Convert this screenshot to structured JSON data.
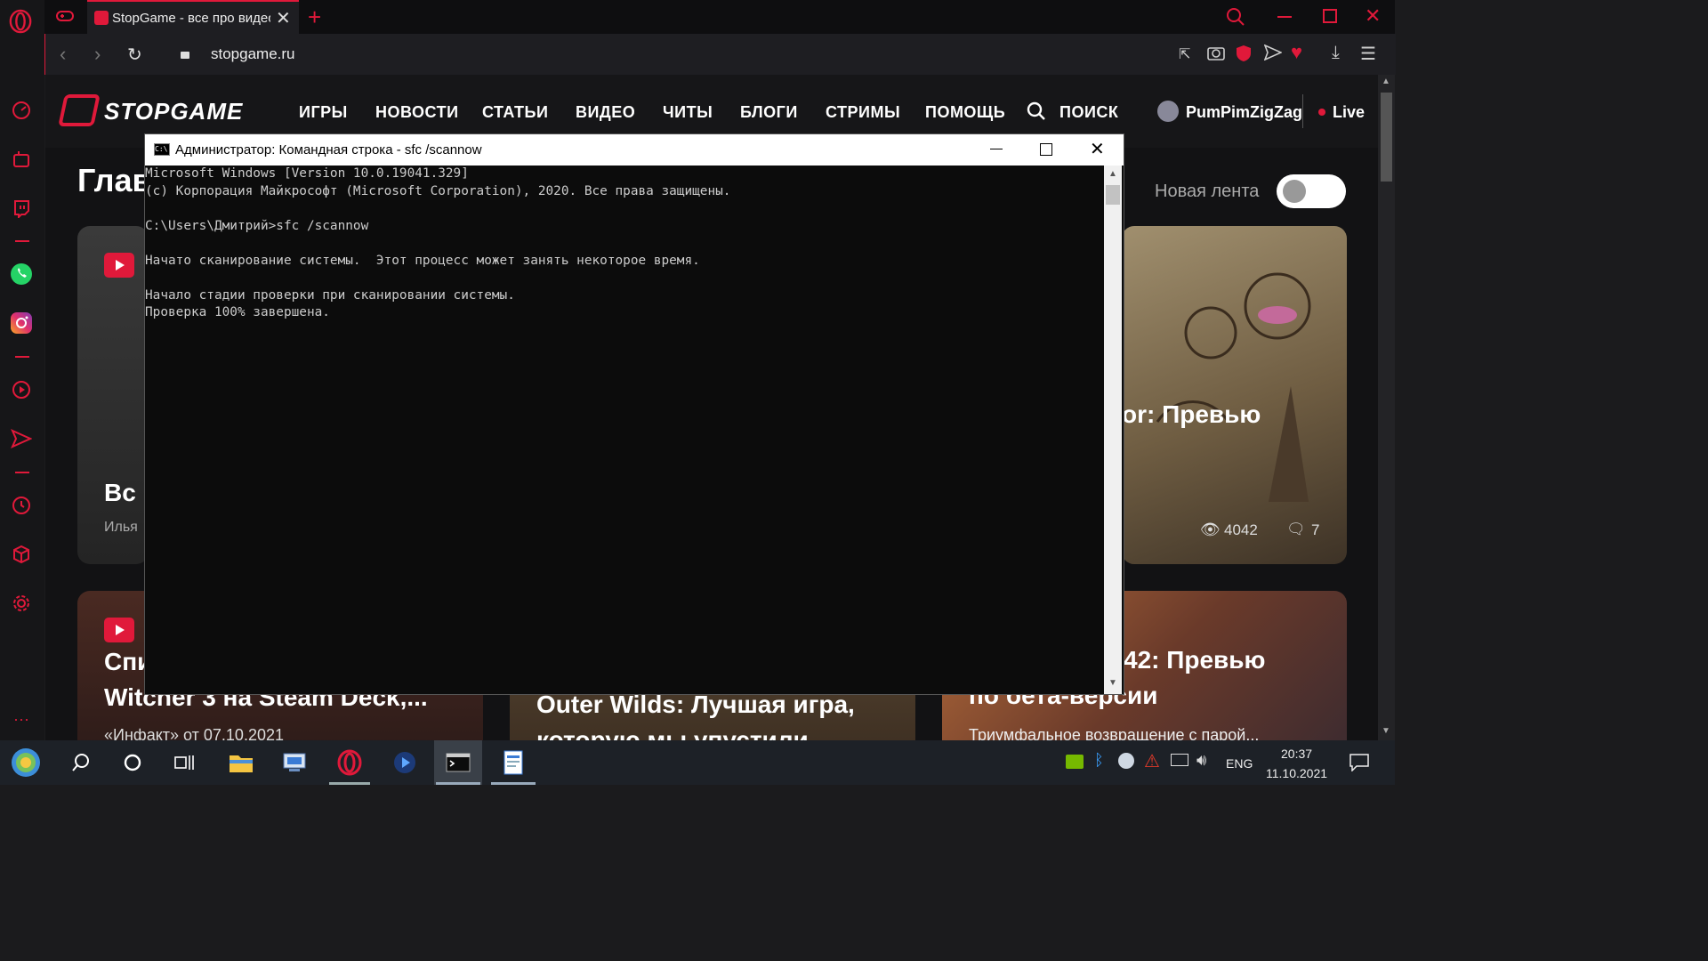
{
  "browser": {
    "tab_title": "StopGame - все про видео",
    "url": "stopgame.ru"
  },
  "site": {
    "logo": "STOPGAME",
    "nav": [
      "ИГРЫ",
      "НОВОСТИ",
      "СТАТЬИ",
      "ВИДЕО",
      "ЧИТЫ",
      "БЛОГИ",
      "СТРИМЫ",
      "ПОМОЩЬ"
    ],
    "search_label": "ПОИСК",
    "username": "PumPimZigZag",
    "live_label": "Live",
    "page_heading_partial": "Глав",
    "new_feed_label": "Новая лента",
    "card1": {
      "title_partial": "Вс",
      "author_partial": "Илья"
    },
    "card2": {
      "title_partial": "or: Превью",
      "views": "4042",
      "comments": "7"
    },
    "card3": {
      "title_line1_partial": "Спи",
      "title_line2": "Witcher 3 на Steam Deck,...",
      "subtitle": "«Инфакт» от 07.10.2021"
    },
    "card4": {
      "title_line1": "Outer Wilds: Лучшая игра,",
      "title_line2": "которую мы упустили"
    },
    "card5": {
      "title_line1": "42: Превью",
      "title_line2": "по бета-версии",
      "subtitle": "Триумфальное возвращение с парой..."
    }
  },
  "cmd": {
    "title": "Администратор: Командная строка - sfc  /scannow",
    "lines": [
      "Microsoft Windows [Version 10.0.19041.329]",
      "(c) Корпорация Майкрософт (Microsoft Corporation), 2020. Все права защищены.",
      "",
      "C:\\Users\\Дмитрий>sfc /scannow",
      "",
      "Начато сканирование системы.  Этот процесс может занять некоторое время.",
      "",
      "Начало стадии проверки при сканировании системы.",
      "Проверка 100% завершена."
    ]
  },
  "taskbar": {
    "lang": "ENG",
    "time": "20:37",
    "date": "11.10.2021"
  },
  "colors": {
    "accent": "#e0193a",
    "cmd_bg": "#0c0c0c"
  }
}
